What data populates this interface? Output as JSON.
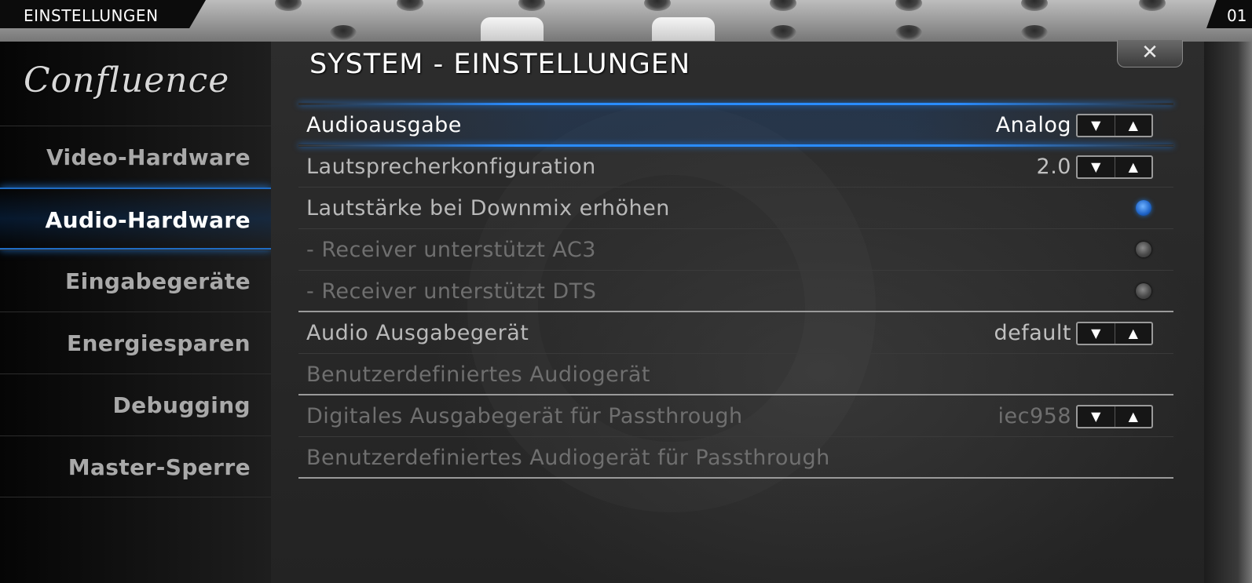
{
  "header": {
    "section_title": "EINSTELLUNGEN",
    "clock_partial": "01"
  },
  "logo": {
    "text": "Confluence"
  },
  "page": {
    "title": "SYSTEM - EINSTELLUNGEN",
    "close_symbol": "✕"
  },
  "sidebar": {
    "items": [
      {
        "label": "Video-Hardware"
      },
      {
        "label": "Audio-Hardware",
        "active": true
      },
      {
        "label": "Eingabegeräte"
      },
      {
        "label": "Energiesparen"
      },
      {
        "label": "Debugging"
      },
      {
        "label": "Master-Sperre"
      }
    ]
  },
  "settings": [
    {
      "label": "Audioausgabe",
      "value": "Analog",
      "control": "spinner",
      "state": "focused"
    },
    {
      "label": "Lautsprecherkonfiguration",
      "value": "2.0",
      "control": "spinner"
    },
    {
      "label": "Lautstärke bei Downmix erhöhen",
      "control": "radio",
      "checked": true
    },
    {
      "label": "- Receiver unterstützt AC3",
      "control": "radio",
      "checked": false,
      "disabled": true
    },
    {
      "label": "- Receiver unterstützt DTS",
      "control": "radio",
      "checked": false,
      "disabled": true
    },
    {
      "label": "Audio Ausgabegerät",
      "value": "default",
      "control": "spinner"
    },
    {
      "label": "Benutzerdefiniertes Audiogerät",
      "control": "none",
      "disabled": true
    },
    {
      "label": "Digitales Ausgabegerät für Passthrough",
      "value": "iec958",
      "control": "spinner",
      "disabled": true
    },
    {
      "label": "Benutzerdefiniertes Audiogerät für Passthrough",
      "control": "none",
      "disabled": true
    }
  ],
  "spinner": {
    "down_symbol": "▼",
    "up_symbol": "▲"
  },
  "colors": {
    "accent": "#2a8cff",
    "background": "#232323",
    "text_active": "#ffffff",
    "text_dim": "#6f6f6f"
  }
}
